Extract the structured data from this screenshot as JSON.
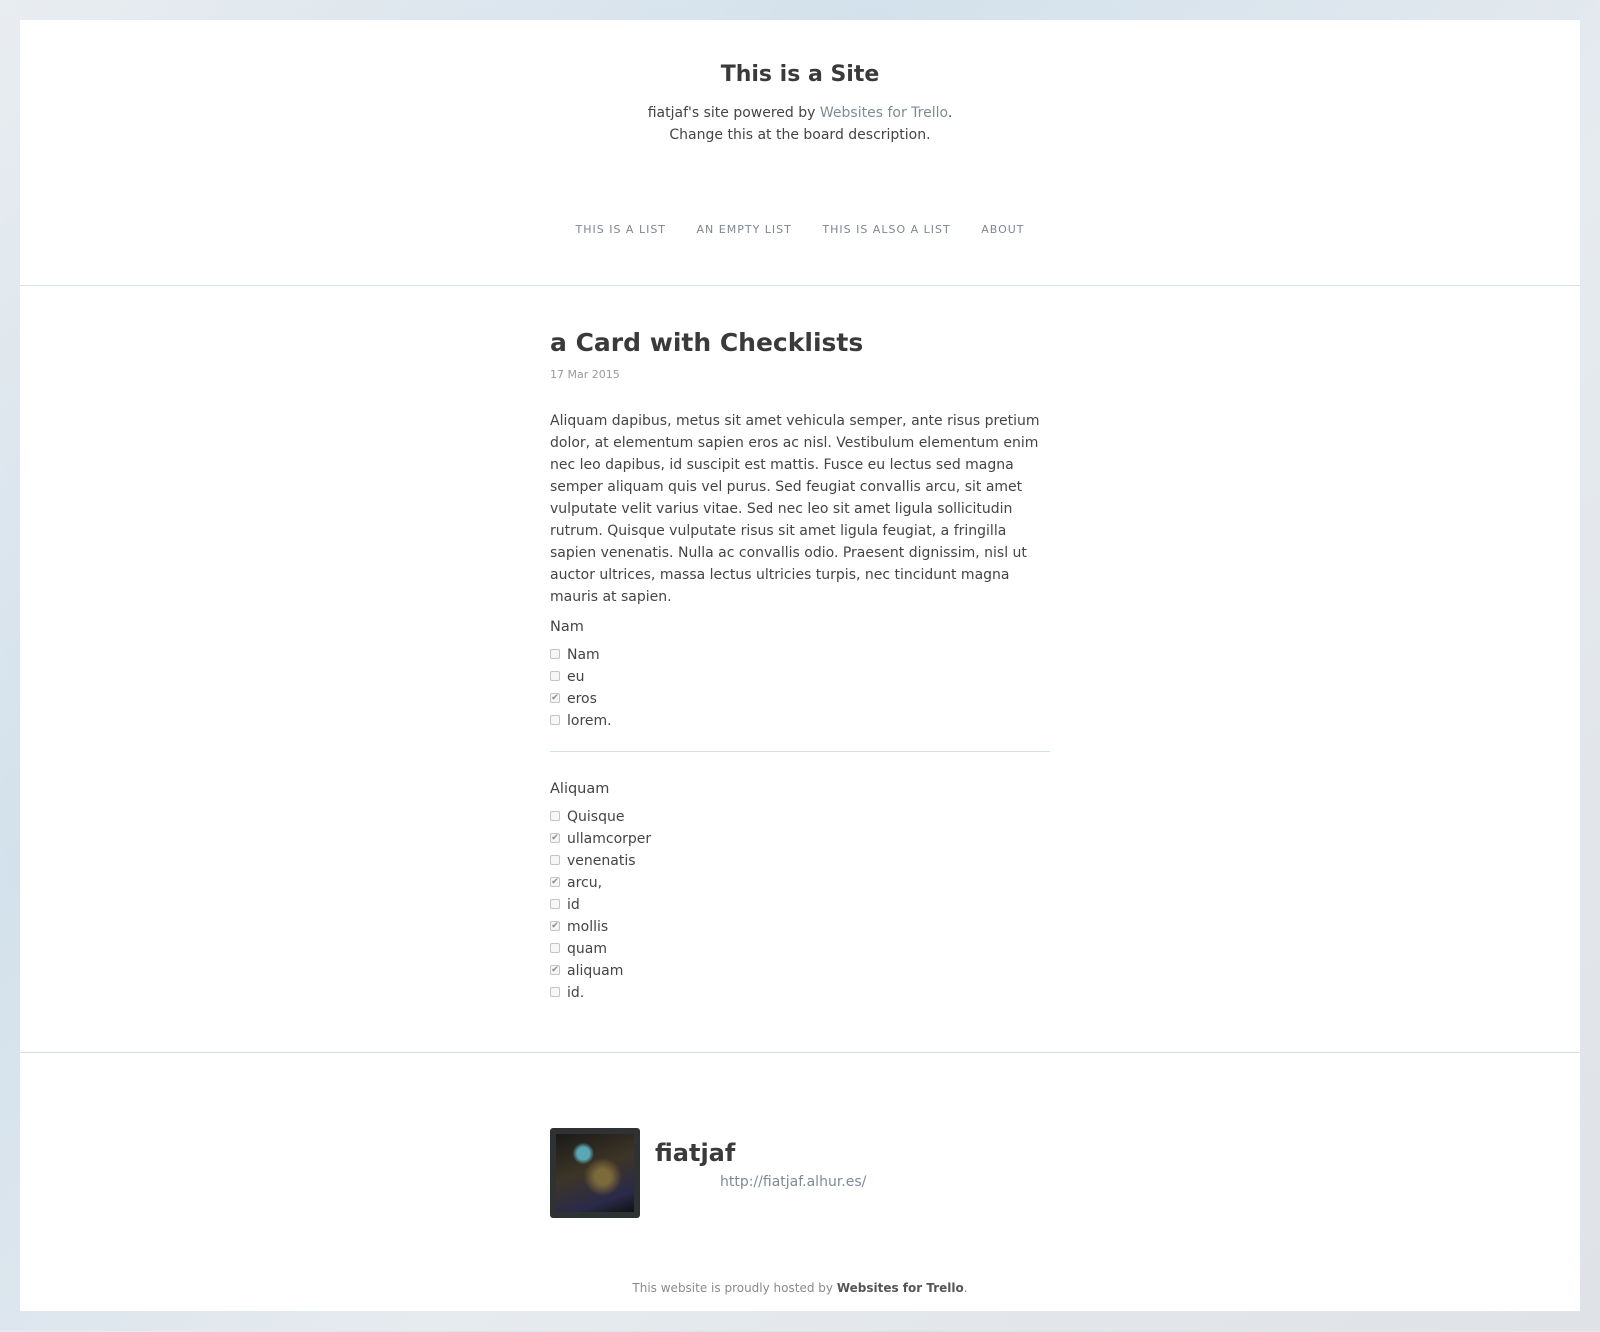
{
  "header": {
    "site_title": "This is a Site",
    "desc_prefix": "fiatjaf's site powered by ",
    "desc_link": "Websites for Trello",
    "desc_suffix": ".",
    "desc_line2": "Change this at the board description."
  },
  "nav": {
    "items": [
      "THIS IS A LIST",
      "AN EMPTY LIST",
      "THIS IS ALSO A LIST",
      "ABOUT"
    ]
  },
  "post": {
    "title": "a Card with Checklists",
    "date": "17 Mar 2015",
    "body": "Aliquam dapibus, metus sit amet vehicula semper, ante risus pretium dolor, at elementum sapien eros ac nisl. Vestibulum elementum enim nec leo dapibus, id suscipit est mattis. Fusce eu lectus sed magna semper aliquam quis vel purus. Sed feugiat convallis arcu, sit amet vulputate velit varius vitae. Sed nec leo sit amet ligula sollicitudin rutrum. Quisque vulputate risus sit amet ligula feugiat, a fringilla sapien venenatis. Nulla ac convallis odio. Praesent dignissim, nisl ut auctor ultrices, massa lectus ultricies turpis, nec tincidunt magna mauris at sapien."
  },
  "checklists": [
    {
      "title": "Nam",
      "items": [
        {
          "label": "Nam",
          "checked": false
        },
        {
          "label": "eu",
          "checked": false
        },
        {
          "label": "eros",
          "checked": true
        },
        {
          "label": "lorem.",
          "checked": false
        }
      ]
    },
    {
      "title": "Aliquam",
      "items": [
        {
          "label": "Quisque",
          "checked": false
        },
        {
          "label": "ullamcorper",
          "checked": true
        },
        {
          "label": "venenatis",
          "checked": false
        },
        {
          "label": "arcu,",
          "checked": true
        },
        {
          "label": "id",
          "checked": false
        },
        {
          "label": "mollis",
          "checked": true
        },
        {
          "label": "quam",
          "checked": false
        },
        {
          "label": "aliquam",
          "checked": true
        },
        {
          "label": "id.",
          "checked": false
        }
      ]
    }
  ],
  "author": {
    "name": "fiatjaf",
    "url": "http://fiatjaf.alhur.es/"
  },
  "footer": {
    "hosted_prefix": "This website is proudly hosted by ",
    "hosted_link": "Websites for Trello",
    "hosted_suffix": "."
  }
}
